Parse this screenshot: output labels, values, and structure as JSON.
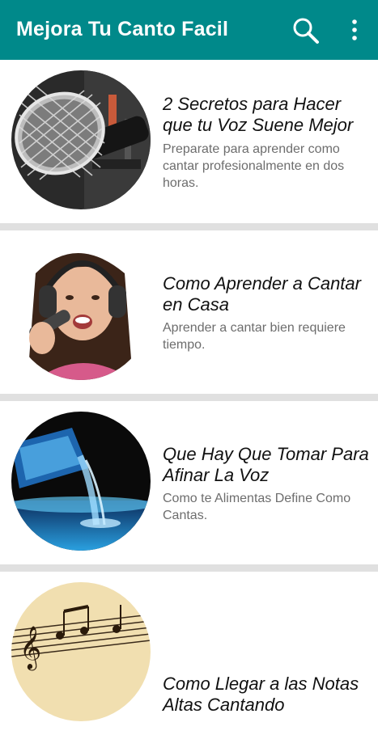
{
  "app_bar": {
    "title": "Mejora Tu Canto Facil",
    "background_color": "#00898a",
    "icons": [
      "search-icon",
      "more-vert-icon"
    ]
  },
  "articles": [
    {
      "title": "2 Secretos para Hacer que tu Voz Suene Mejor",
      "description": "Preparate para aprender como cantar profesionalmente en dos horas.",
      "image": "microphone-image"
    },
    {
      "title": "Como Aprender a Cantar en Casa",
      "description": "Aprender a cantar bien requiere tiempo.",
      "image": "girl-singing-headphones-image"
    },
    {
      "title": "Que Hay Que Tomar Para Afinar La Voz",
      "description": "Como te Alimentas Define Como Cantas.",
      "image": "water-bottle-pouring-image"
    },
    {
      "title": "Como Llegar a las Notas Altas Cantando",
      "description": "",
      "image": "music-sheet-notes-image"
    }
  ]
}
